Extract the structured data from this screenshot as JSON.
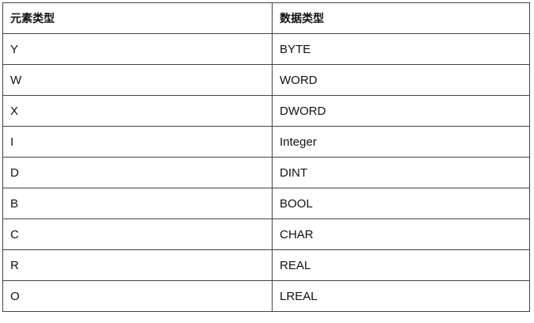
{
  "table": {
    "headers": [
      "元素类型",
      "数据类型"
    ],
    "rows": [
      [
        "Y",
        "BYTE"
      ],
      [
        "W",
        "WORD"
      ],
      [
        "X",
        "DWORD"
      ],
      [
        "I",
        "Integer"
      ],
      [
        "D",
        "DINT"
      ],
      [
        "B",
        "BOOL"
      ],
      [
        "C",
        "CHAR"
      ],
      [
        "R",
        "REAL"
      ],
      [
        "O",
        "LREAL"
      ]
    ]
  }
}
